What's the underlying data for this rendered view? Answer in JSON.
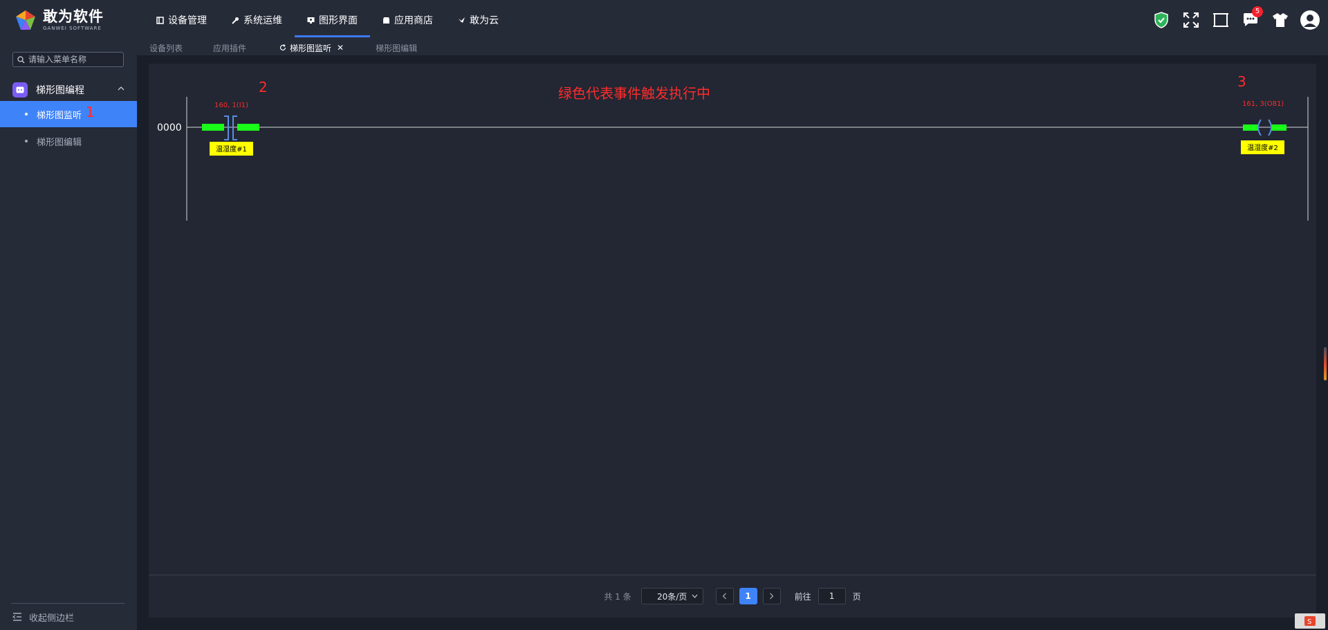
{
  "app": {
    "logo_cn": "敢为软件",
    "logo_en": "GANWEI SOFTWARE"
  },
  "nav": [
    {
      "label": "设备管理",
      "icon": "device-list-icon"
    },
    {
      "label": "系统运维",
      "icon": "wrench-icon"
    },
    {
      "label": "图形界面",
      "icon": "monitor-icon",
      "active": true
    },
    {
      "label": "应用商店",
      "icon": "store-icon"
    },
    {
      "label": "敢为云",
      "icon": "bird-icon"
    }
  ],
  "top_right": {
    "notification_count": "5",
    "icons": [
      "shield-icon",
      "fullscreen-icon",
      "frame-icon",
      "chat-icon",
      "shirt-icon",
      "user-avatar-icon"
    ]
  },
  "sidebar": {
    "search_placeholder": "请输入菜单名称",
    "group_label": "梯形图编程",
    "items": [
      {
        "label": "梯形图监听",
        "active": true
      },
      {
        "label": "梯形图编辑",
        "active": false
      }
    ],
    "collapse_label": "收起侧边栏"
  },
  "tabs": [
    {
      "label": "设备列表"
    },
    {
      "label": "应用插件"
    },
    {
      "label": "梯形图监听",
      "active": true,
      "closable": true
    },
    {
      "label": "梯形图编辑"
    }
  ],
  "annotations": {
    "a1": "1",
    "a2": "2",
    "a3": "3",
    "headline": "绿色代表事件触发执行中"
  },
  "ladder": {
    "rung_number": "0000",
    "contact": {
      "address": "160, 1(I1)",
      "label": "温湿度#1"
    },
    "coil": {
      "address": "161, 3(O81)",
      "label": "温湿度#2"
    },
    "active_color": "#1aff1a",
    "label_bg": "#ffff00",
    "annotation_color": "#ff2b2b"
  },
  "pagination": {
    "total": "共 1 条",
    "page_size": "20条/页",
    "current_page": "1",
    "goto_label": "前往",
    "goto_value": "1",
    "page_unit": "页"
  }
}
